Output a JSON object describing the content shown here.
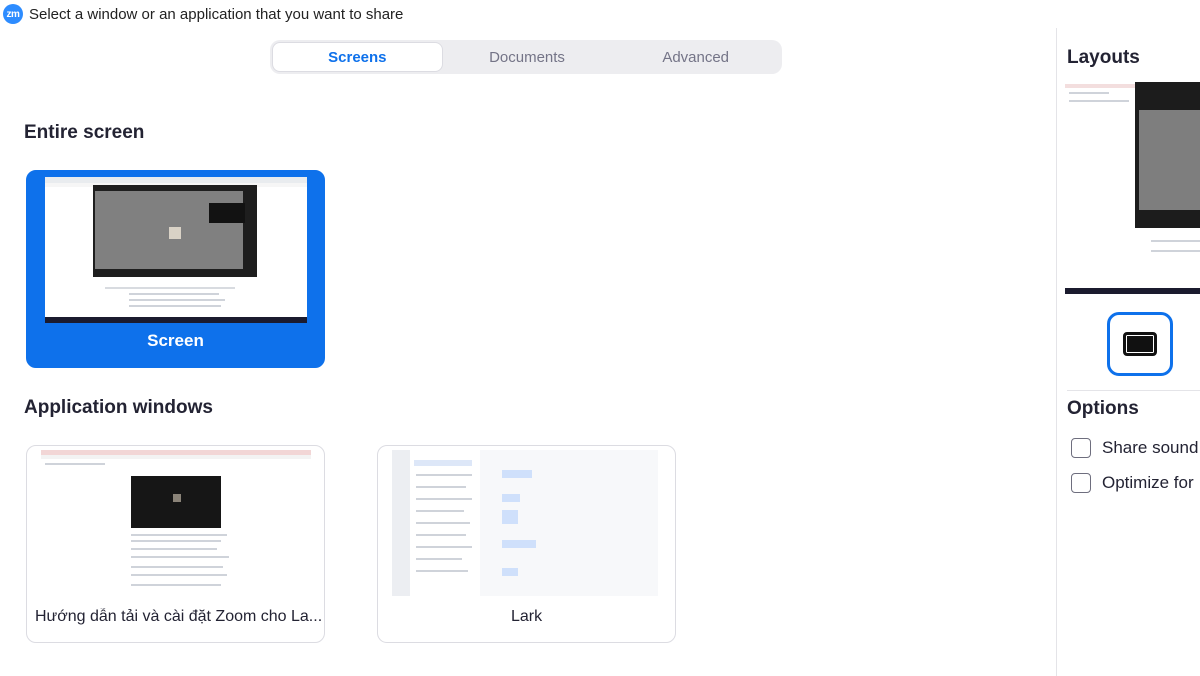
{
  "window": {
    "logo_text": "zm",
    "title": "Select a window or an application that you want to share"
  },
  "tabs": [
    {
      "label": "Screens",
      "active": true
    },
    {
      "label": "Documents",
      "active": false
    },
    {
      "label": "Advanced",
      "active": false
    }
  ],
  "sections": {
    "entire_screen": "Entire screen",
    "application_windows": "Application windows"
  },
  "screens": [
    {
      "label": "Screen",
      "selected": true
    }
  ],
  "apps": [
    {
      "label": "Hướng dẫn tải và cài đặt Zoom cho La..."
    },
    {
      "label": "Lark"
    }
  ],
  "sidebar": {
    "layouts_title": "Layouts",
    "options_title": "Options",
    "options": [
      {
        "label": "Share sound",
        "checked": false
      },
      {
        "label": "Optimize for",
        "checked": false
      }
    ]
  },
  "colors": {
    "accent": "#0E71EB",
    "logo": "#2D8CFF"
  }
}
